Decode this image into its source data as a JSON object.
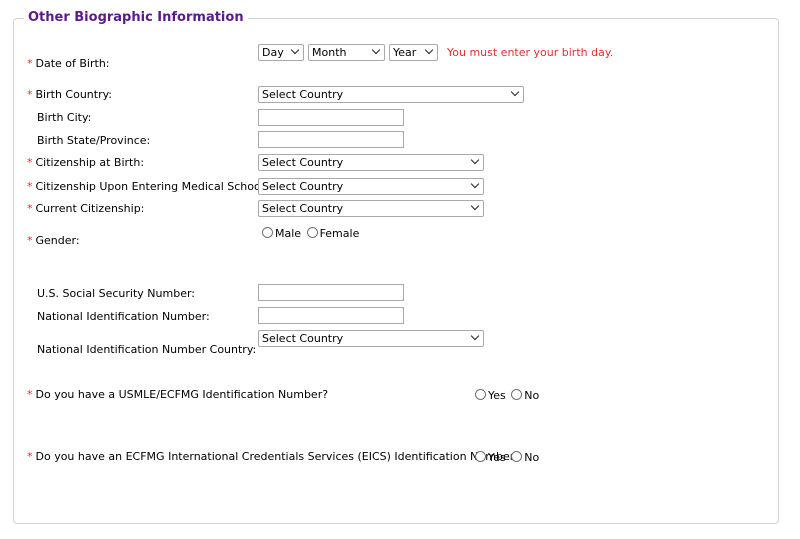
{
  "section_title": "Other Biographic Information",
  "fields": {
    "dob": {
      "label": "Date of Birth:",
      "day": "Day",
      "month": "Month",
      "year": "Year",
      "error": "You must enter  your birth day."
    },
    "birth_country": {
      "label": "Birth Country:",
      "value": "Select Country"
    },
    "birth_city": {
      "label": "Birth City:",
      "value": ""
    },
    "birth_state": {
      "label": "Birth State/Province:",
      "value": ""
    },
    "citizenship_birth": {
      "label": "Citizenship at Birth:",
      "value": "Select Country"
    },
    "citizenship_med": {
      "label": "Citizenship Upon Entering Medical School:",
      "value": "Select Country"
    },
    "current_citizenship": {
      "label": "Current Citizenship:",
      "value": "Select Country"
    },
    "gender": {
      "label": "Gender:",
      "options": [
        "Male",
        "Female"
      ]
    },
    "ssn": {
      "label": "U.S. Social Security Number:",
      "value": ""
    },
    "national_id": {
      "label": "National Identification Number:",
      "value": ""
    },
    "national_id_country": {
      "label": "National Identification Number Country:",
      "value": "Select Country"
    },
    "usmle": {
      "label": "Do you have a USMLE/ECFMG Identification Number?",
      "options": [
        "Yes",
        "No"
      ]
    },
    "eics": {
      "label": "Do you have an ECFMG International Credentials Services (EICS) Identification Number?",
      "options": [
        "Yes",
        "No"
      ]
    }
  },
  "colors": {
    "legend": "#5b1b8c",
    "required": "#e0302f",
    "error": "#e0302f"
  }
}
